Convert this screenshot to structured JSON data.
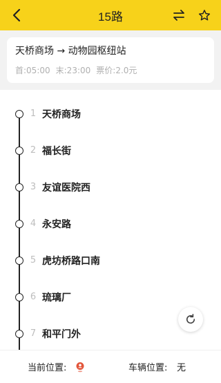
{
  "header": {
    "title": "15路",
    "back_icon": "back-arrow-icon",
    "swap_icon": "swap-direction-icon",
    "favorite_icon": "star-icon",
    "background": "#F7D21A"
  },
  "route": {
    "from_to": "天桥商场 → 动物园枢纽站",
    "first_bus": "首:05:00",
    "last_bus": "末:23:00",
    "fare": "票价:2.0元"
  },
  "stops": [
    {
      "num": "1",
      "name": "天桥商场"
    },
    {
      "num": "2",
      "name": "福长街"
    },
    {
      "num": "3",
      "name": "友谊医院西"
    },
    {
      "num": "4",
      "name": "永安路"
    },
    {
      "num": "5",
      "name": "虎坊桥路口南"
    },
    {
      "num": "6",
      "name": "琉璃厂"
    },
    {
      "num": "7",
      "name": "和平门外"
    }
  ],
  "bottom": {
    "current_position_label": "当前位置:",
    "location_icon": "location-pin-icon",
    "vehicle_position_label": "车辆位置:",
    "vehicle_position_value": "无"
  },
  "refresh_icon": "refresh-icon"
}
